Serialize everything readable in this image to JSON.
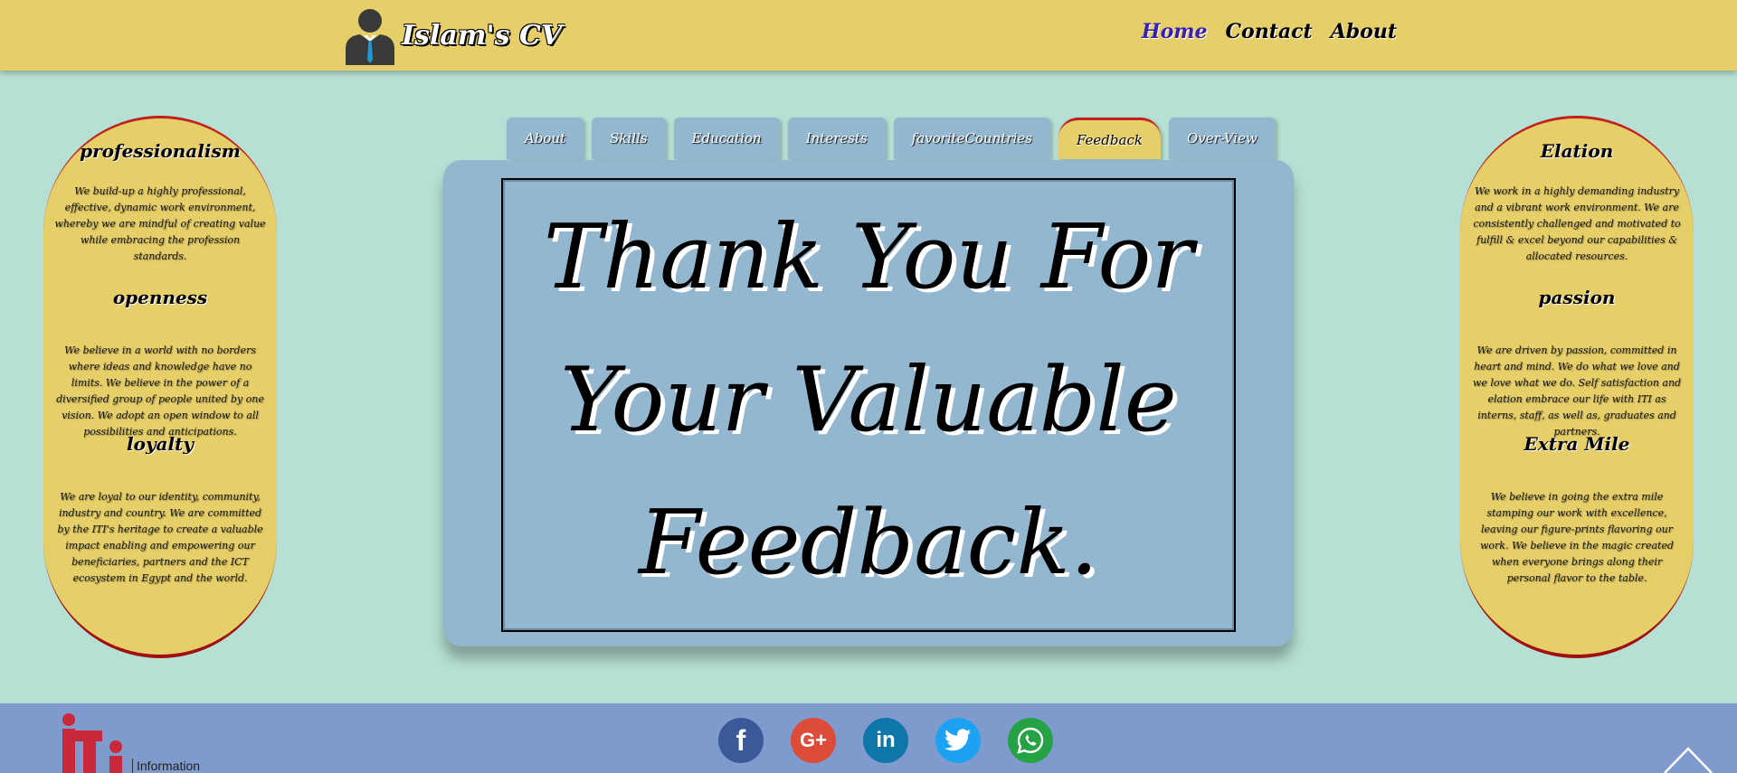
{
  "header": {
    "brand_title": "Islam's CV",
    "nav": [
      {
        "label": "Home",
        "active": true
      },
      {
        "label": "Contact",
        "active": false
      },
      {
        "label": "About",
        "active": false
      }
    ]
  },
  "left_pill": {
    "sections": [
      {
        "title": "professionalism",
        "text": "We build-up a highly professional, effective, dynamic work environment, whereby we are mindful of creating value while embracing the profession standards."
      },
      {
        "title": "openness",
        "text": "We believe in a world with no borders where ideas and knowledge have no limits. We believe in the power of a diversified group of people united by one vision. We adopt an open window to all possibilities and anticipations."
      },
      {
        "title": "loyalty",
        "text": "We are loyal to our identity, community, industry and country. We are committed by the ITI's heritage to create a valuable impact enabling and empowering our beneficiaries, partners and the ICT ecosystem in Egypt and the world."
      }
    ]
  },
  "right_pill": {
    "sections": [
      {
        "title": "Elation",
        "text": "We work in a highly demanding industry and a vibrant work environment. We are consistently challenged and motivated to fulfill & excel beyond our capabilities & allocated resources."
      },
      {
        "title": "passion",
        "text": "We are driven by passion, committed in heart and mind. We do what we love and we love what we do. Self satisfaction and elation embrace our life with ITI as interns, staff, as well as, graduates and partners."
      },
      {
        "title": "Extra Mile",
        "text": "We believe in going the extra mile stamping our work with excellence, leaving our figure-prints flavoring our work. We believe in the magic created when everyone brings along their personal flavor to the table."
      }
    ]
  },
  "tabs": [
    {
      "label": "About",
      "active": false
    },
    {
      "label": "Skills",
      "active": false
    },
    {
      "label": "Education",
      "active": false
    },
    {
      "label": "Interests",
      "active": false
    },
    {
      "label": "favoriteCountries",
      "active": false
    },
    {
      "label": "Feedback",
      "active": true
    },
    {
      "label": "Over-View",
      "active": false
    }
  ],
  "main": {
    "message": "Thank You For Your Valuable Feedback."
  },
  "footer": {
    "iti_text": "Information",
    "socials": [
      {
        "name": "facebook",
        "glyph": "f",
        "color": "#3b5998"
      },
      {
        "name": "google-plus",
        "glyph": "G+",
        "color": "#dd4b39"
      },
      {
        "name": "linkedin",
        "glyph": "in",
        "color": "#0e76a8"
      },
      {
        "name": "twitter",
        "glyph": "t",
        "color": "#1da1f2"
      },
      {
        "name": "whatsapp",
        "glyph": "w",
        "color": "#25a244"
      }
    ]
  },
  "colors": {
    "page_bg": "#b6e0d3",
    "header_bg": "#e6cf68",
    "card_bg": "#94b7d0",
    "footer_bg": "#7f9bce",
    "accent_red": "#c0201e"
  }
}
